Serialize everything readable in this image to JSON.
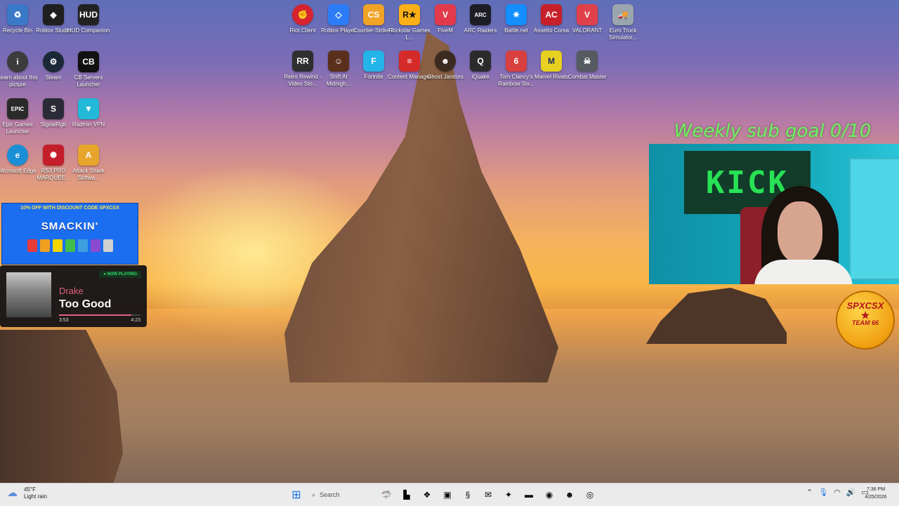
{
  "desktop_icons": [
    {
      "label": "Recycle Bin",
      "icon": "recycle-bin-icon",
      "color": "#3a78c8"
    },
    {
      "label": "Roblox Studio",
      "icon": "roblox-studio-icon",
      "color": "#1f1f1f"
    },
    {
      "label": "HUD Companion",
      "icon": "hud-icon",
      "color": "#222222"
    },
    {
      "label": "Learn about this picture",
      "icon": "info-icon",
      "color": "#3c3c3c"
    },
    {
      "label": "Steam",
      "icon": "steam-icon",
      "color": "#1b2838"
    },
    {
      "label": "CB Servers Launcher",
      "icon": "cb-icon",
      "color": "#111111"
    },
    {
      "label": "Epic Games Launcher",
      "icon": "epic-games-icon",
      "color": "#2a2a2a"
    },
    {
      "label": "SignalRgb",
      "icon": "signalrgb-icon",
      "color": "#2b2b38"
    },
    {
      "label": "Radmin VPN",
      "icon": "radmin-vpn-icon",
      "color": "#22b8d8"
    },
    {
      "label": "Microsoft Edge",
      "icon": "edge-icon",
      "color": "#1a8fd6"
    },
    {
      "label": "RS3 PRO MARQUEE...",
      "icon": "rs3-icon",
      "color": "#c41e2a"
    },
    {
      "label": "Attack Shark Softwa...",
      "icon": "attack-shark-icon",
      "color": "#e8a52c"
    },
    {
      "label": "Riot Client",
      "icon": "riot-client-icon",
      "color": "#d7232f"
    },
    {
      "label": "Roblox Player",
      "icon": "roblox-player-icon",
      "color": "#2b7cf6"
    },
    {
      "label": "Counter-Strike 2",
      "icon": "counter-strike-icon",
      "color": "#f0a324"
    },
    {
      "label": "Rockstar Games L...",
      "icon": "rockstar-icon",
      "color": "#fcaf17"
    },
    {
      "label": "FiveM",
      "icon": "fivem-icon",
      "color": "#e23a4a"
    },
    {
      "label": "ARC Raiders",
      "icon": "arc-raiders-icon",
      "color": "#1d1d25"
    },
    {
      "label": "Battle.net",
      "icon": "battlenet-icon",
      "color": "#148eff"
    },
    {
      "label": "Assetto Corsa",
      "icon": "assetto-corsa-icon",
      "color": "#c8202a"
    },
    {
      "label": "VALORANT",
      "icon": "valorant-icon",
      "color": "#e0404a"
    },
    {
      "label": "Euro Truck Simulator...",
      "icon": "euro-truck-icon",
      "color": "#9aa5ad"
    },
    {
      "label": "Retro Rewind - Video Sto...",
      "icon": "retro-rewind-icon",
      "color": "#2f2f2f"
    },
    {
      "label": "Shift At Midnigh...",
      "icon": "shift-at-midnight-icon",
      "color": "#5a2f1c"
    },
    {
      "label": "Fortnite",
      "icon": "fortnite-icon",
      "color": "#25b4ea"
    },
    {
      "label": "Content Manager",
      "icon": "content-manager-icon",
      "color": "#d42a2a"
    },
    {
      "label": "Ghost Janitors",
      "icon": "ghost-janitors-icon",
      "color": "#3b2a20"
    },
    {
      "label": "iQuake",
      "icon": "iquake-icon",
      "color": "#2b2b2b"
    },
    {
      "label": "Tom Clancy's Rainbow Six...",
      "icon": "rainbow-six-icon",
      "color": "#d84040"
    },
    {
      "label": "Marvel Rivals",
      "icon": "marvel-rivals-icon",
      "color": "#e8d020"
    },
    {
      "label": "Combat Master",
      "icon": "combat-master-icon",
      "color": "#555b60"
    }
  ],
  "stream_overlay": {
    "goal_text": "Weekly sub goal 0/10",
    "kick_banner": "KICK",
    "team_badge": {
      "top": "SPXCSX",
      "star": "★",
      "bottom": "TEAM 66"
    }
  },
  "promo": {
    "top_text": "10% OFF WITH DISCOUNT CODE SPXCSX",
    "brand": "SMACKIN'",
    "pack_colors": [
      "#e63b3b",
      "#f0a020",
      "#f4d400",
      "#3fbf4a",
      "#3fa0e0",
      "#8a4ad0",
      "#d0d0d0"
    ]
  },
  "now_playing": {
    "badge": "● NOW PLAYING",
    "artist": "Drake",
    "song": "Too Good",
    "elapsed": "3:53",
    "total": "4:23",
    "progress": 0.885
  },
  "taskbar": {
    "weather_temp": "45°F",
    "weather_desc": "Light rain",
    "search_placeholder": "Search",
    "clock_time": "7:36 PM",
    "clock_date": "4/25/2026",
    "apps": [
      {
        "name": "shark-app-icon",
        "glyph": "🦈"
      },
      {
        "name": "terminal-icon",
        "glyph": "▙"
      },
      {
        "name": "copilot-icon",
        "glyph": "❖"
      },
      {
        "name": "store-icon",
        "glyph": "▣"
      },
      {
        "name": "signal-app-icon",
        "glyph": "§"
      },
      {
        "name": "mail-icon",
        "glyph": "✉"
      },
      {
        "name": "game-app-icon",
        "glyph": "✦"
      },
      {
        "name": "file-explorer-icon",
        "glyph": "▬"
      },
      {
        "name": "edge-taskbar-icon",
        "glyph": "◉"
      },
      {
        "name": "discord-icon",
        "glyph": "☻"
      },
      {
        "name": "chrome-icon",
        "glyph": "◎"
      }
    ]
  }
}
